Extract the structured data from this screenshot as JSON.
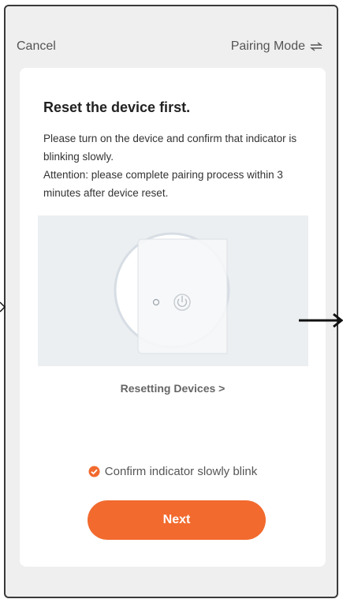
{
  "header": {
    "cancel_label": "Cancel",
    "mode_label": "Pairing Mode",
    "mode_icon": "swap-icon"
  },
  "card": {
    "title": "Reset the device first.",
    "description_line1": "Please turn on the device and confirm that indicator is blinking slowly.",
    "description_line2": "Attention: please complete pairing process within 3 minutes after device reset.",
    "illustration_icon": "power-icon",
    "resetting_link": "Resetting Devices >",
    "confirm_label": "Confirm indicator slowly blink",
    "confirm_checked": true,
    "next_label": "Next"
  },
  "colors": {
    "accent": "#f26a2e",
    "background": "#efefef",
    "card": "#ffffff"
  }
}
